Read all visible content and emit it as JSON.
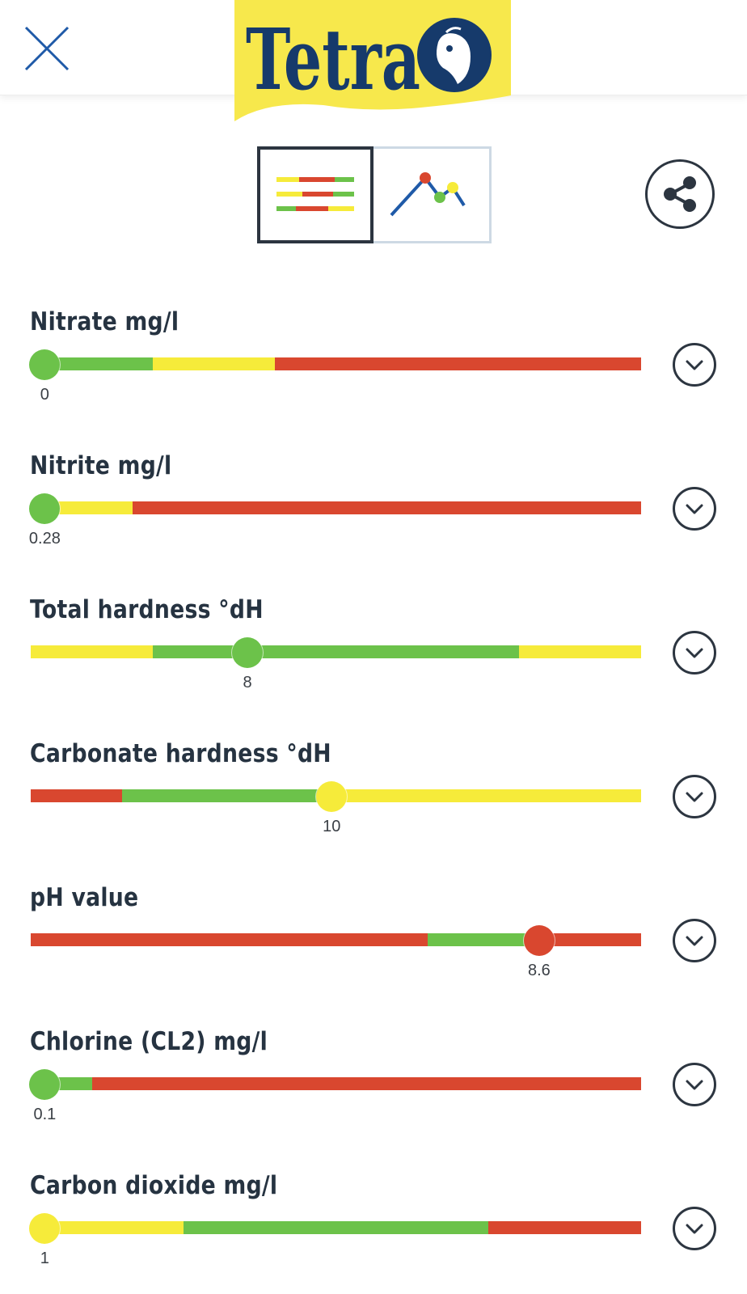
{
  "header": {
    "logo_text": "Tetra",
    "brand_yellow": "#f7e84c",
    "brand_navy": "#163a6b",
    "close_icon": "close-icon"
  },
  "view_toggle": {
    "options": [
      {
        "name": "list-view",
        "icon": "colored-bars-icon",
        "selected": true
      },
      {
        "name": "chart-view",
        "icon": "line-chart-icon",
        "selected": false
      }
    ]
  },
  "share": {
    "icon": "share-icon"
  },
  "colors": {
    "green": "#6cc24a",
    "yellow": "#f6eb3a",
    "red": "#d9472f"
  },
  "parameters": [
    {
      "label": "Nitrate mg/l",
      "value": "0",
      "marker_position": 0.023,
      "marker_color": "green",
      "segments": [
        {
          "color": "green",
          "fraction": 0.2
        },
        {
          "color": "yellow",
          "fraction": 0.2
        },
        {
          "color": "red",
          "fraction": 0.6
        }
      ]
    },
    {
      "label": "Nitrite mg/l",
      "value": "0.28",
      "marker_position": 0.023,
      "marker_color": "green",
      "segments": [
        {
          "color": "yellow",
          "fraction": 0.167
        },
        {
          "color": "red",
          "fraction": 0.833
        }
      ]
    },
    {
      "label": "Total hardness °dH",
      "value": "8",
      "marker_position": 0.355,
      "marker_color": "green",
      "segments": [
        {
          "color": "yellow",
          "fraction": 0.2
        },
        {
          "color": "green",
          "fraction": 0.6
        },
        {
          "color": "yellow",
          "fraction": 0.2
        }
      ]
    },
    {
      "label": "Carbonate hardness °dH",
      "value": "10",
      "marker_position": 0.493,
      "marker_color": "yellow",
      "segments": [
        {
          "color": "red",
          "fraction": 0.15
        },
        {
          "color": "green",
          "fraction": 0.35
        },
        {
          "color": "yellow",
          "fraction": 0.5
        }
      ]
    },
    {
      "label": "pH value",
      "value": "8.6",
      "marker_position": 0.833,
      "marker_color": "red",
      "segments": [
        {
          "color": "red",
          "fraction": 0.65
        },
        {
          "color": "green",
          "fraction": 0.17
        },
        {
          "color": "red",
          "fraction": 0.18
        }
      ]
    },
    {
      "label": "Chlorine (CL2) mg/l",
      "value": "0.1",
      "marker_position": 0.023,
      "marker_color": "green",
      "segments": [
        {
          "color": "green",
          "fraction": 0.1
        },
        {
          "color": "red",
          "fraction": 0.9
        }
      ]
    },
    {
      "label": "Carbon dioxide mg/l",
      "value": "1",
      "marker_position": 0.023,
      "marker_color": "yellow",
      "segments": [
        {
          "color": "yellow",
          "fraction": 0.25
        },
        {
          "color": "green",
          "fraction": 0.5
        },
        {
          "color": "red",
          "fraction": 0.25
        }
      ]
    }
  ]
}
